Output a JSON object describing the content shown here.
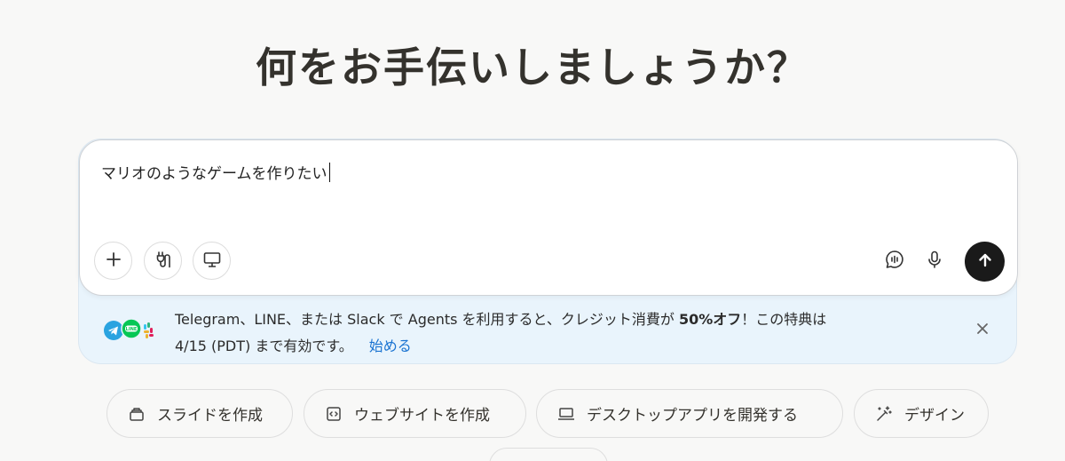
{
  "headline": "何をお手伝いしましょうか？",
  "composer": {
    "input_value": "マリオのようなゲームを作りたい",
    "buttons": {
      "add": "plus-icon",
      "connectors": "plug-icon",
      "computer": "monitor-icon",
      "feedback": "chat-bubble-icon",
      "voice": "microphone-icon",
      "send": "arrow-up-icon"
    }
  },
  "banner": {
    "line1_pre": "Telegram、LINE、または Slack で Agents を利用すると、クレジット消費が ",
    "line1_bold": "50%オフ",
    "line1_post": "！この特典は",
    "line2": "4/15 (PDT) まで有効です。",
    "link": "始める",
    "logos": [
      "telegram-logo",
      "line-logo",
      "slack-logo"
    ]
  },
  "chips": [
    {
      "label": "スライドを作成",
      "icon": "slides-icon"
    },
    {
      "label": "ウェブサイトを作成",
      "icon": "code-window-icon"
    },
    {
      "label": "デスクトップアプリを開発する",
      "icon": "laptop-icon"
    },
    {
      "label": "デザイン",
      "icon": "magic-wand-icon"
    }
  ],
  "colors": {
    "background": "#f8f8f7",
    "banner_bg": "#e9f4fc",
    "link": "#1a73d1",
    "send_button": "#1a1a1a"
  }
}
